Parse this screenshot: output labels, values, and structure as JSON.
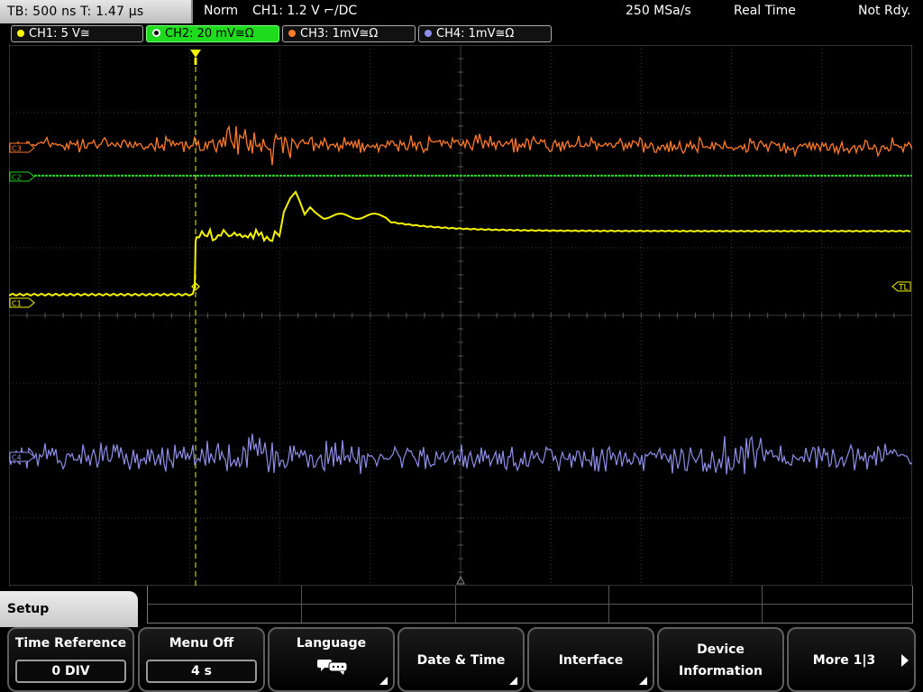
{
  "status_bar": {
    "timebase": "TB: 500 ns   T: 1.47 µs",
    "trigger_mode": "Norm",
    "trigger_info": "CH1: 1.2 V ⌐/DC",
    "sample_rate": "250 MSa/s",
    "acq_mode": "Real Time",
    "state": "Not Rdy."
  },
  "channels": [
    {
      "label": "CH1: 5 V≅",
      "color": "#ffff00",
      "active": false
    },
    {
      "label": "CH2: 20 mV≅Ω",
      "color": "#22dd22",
      "active": true
    },
    {
      "label": "CH3: 1mV≅Ω",
      "color": "#ff7a2a",
      "active": false
    },
    {
      "label": "CH4: 1mV≅Ω",
      "color": "#8e8ee8",
      "active": false
    }
  ],
  "markers": {
    "c3": "C3",
    "c2": "C2",
    "c1": "C1",
    "c4": "C4",
    "trigger_level": "TL"
  },
  "colors": {
    "ch1": "#f4f400",
    "ch2": "#22cc22",
    "ch3": "#ff7a2a",
    "ch4": "#8e8ee8",
    "grid": "#3a3a3a"
  },
  "menu": {
    "title": "Setup",
    "softkeys": [
      {
        "label": "Time Reference",
        "value": "0 DIV"
      },
      {
        "label": "Menu Off",
        "value": "4 s"
      },
      {
        "label": "Language",
        "icon": "speech-bubbles-icon"
      },
      {
        "label": "Date & Time"
      },
      {
        "label": "Interface"
      },
      {
        "label": "Device",
        "label2": "Information"
      },
      {
        "label": "More 1|3"
      }
    ]
  }
}
